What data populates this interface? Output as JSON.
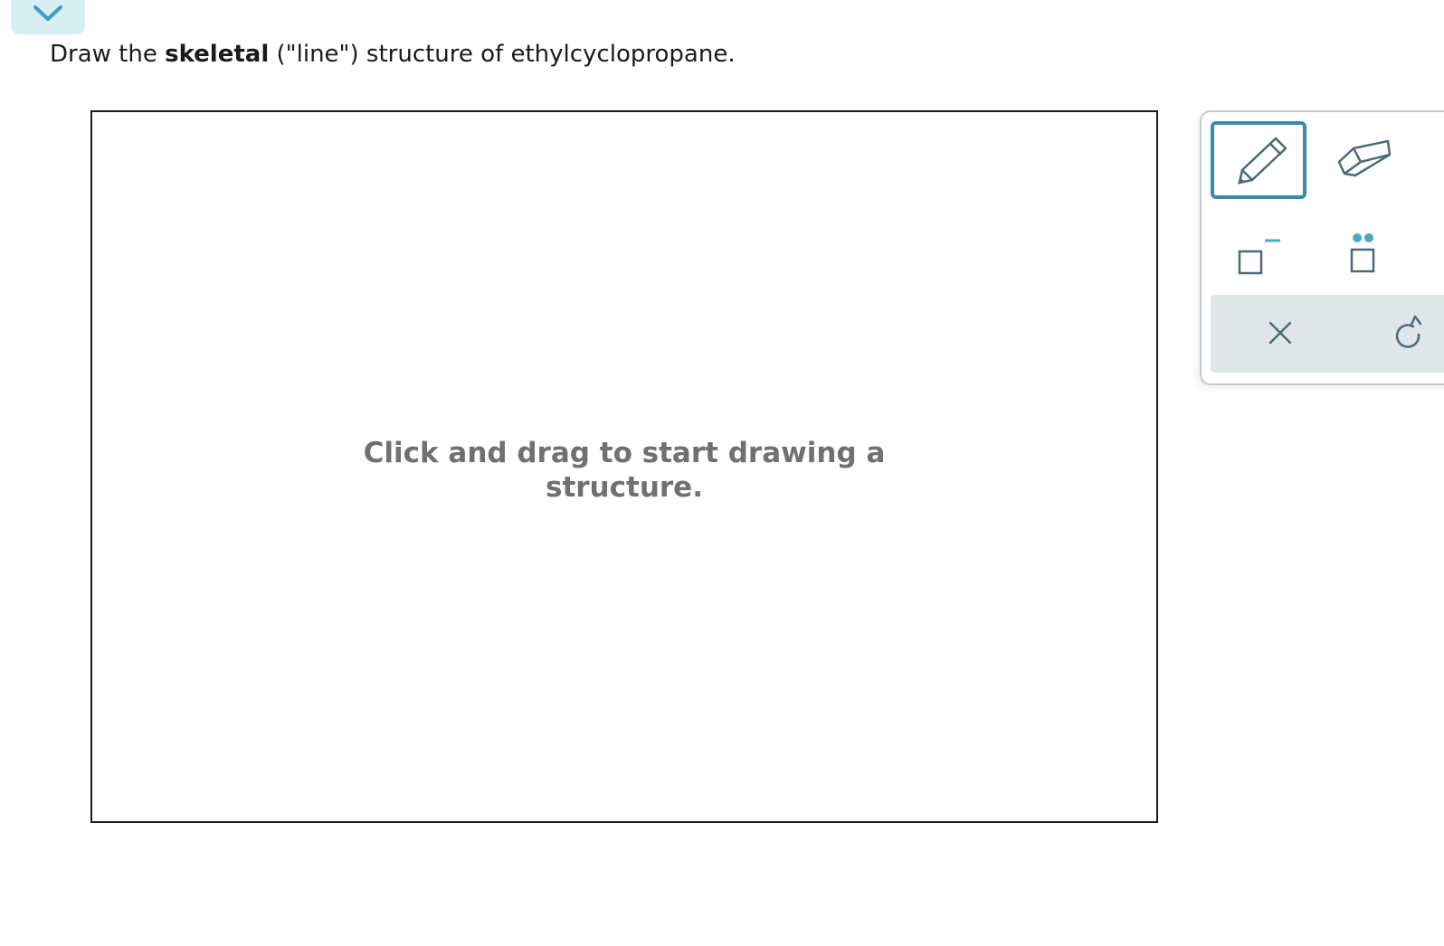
{
  "header": {
    "collapse_icon": "chevron-down-icon"
  },
  "question": {
    "prefix": "Draw the",
    "bold": "skeletal",
    "suffix": "(\"line\") structure of ethylcyclopropane."
  },
  "canvas": {
    "hint_line1": "Click and drag to start drawing a",
    "hint_line2": "structure."
  },
  "toolbox": {
    "tools": [
      {
        "icon": "pencil-icon",
        "selected": true
      },
      {
        "icon": "eraser-icon",
        "selected": false
      },
      {
        "icon": "charge-icon",
        "selected": false
      },
      {
        "icon": "lone-pair-icon",
        "selected": false
      }
    ],
    "actions": [
      {
        "icon": "close-icon"
      },
      {
        "icon": "undo-icon"
      }
    ]
  },
  "colors": {
    "accent": "#3a8ba8",
    "icon": "#4a6a78",
    "teal_dot": "#4aa8c8",
    "tab_bg": "#d7eef3",
    "action_bar": "#e0e6e8",
    "hint_text": "#707070"
  }
}
